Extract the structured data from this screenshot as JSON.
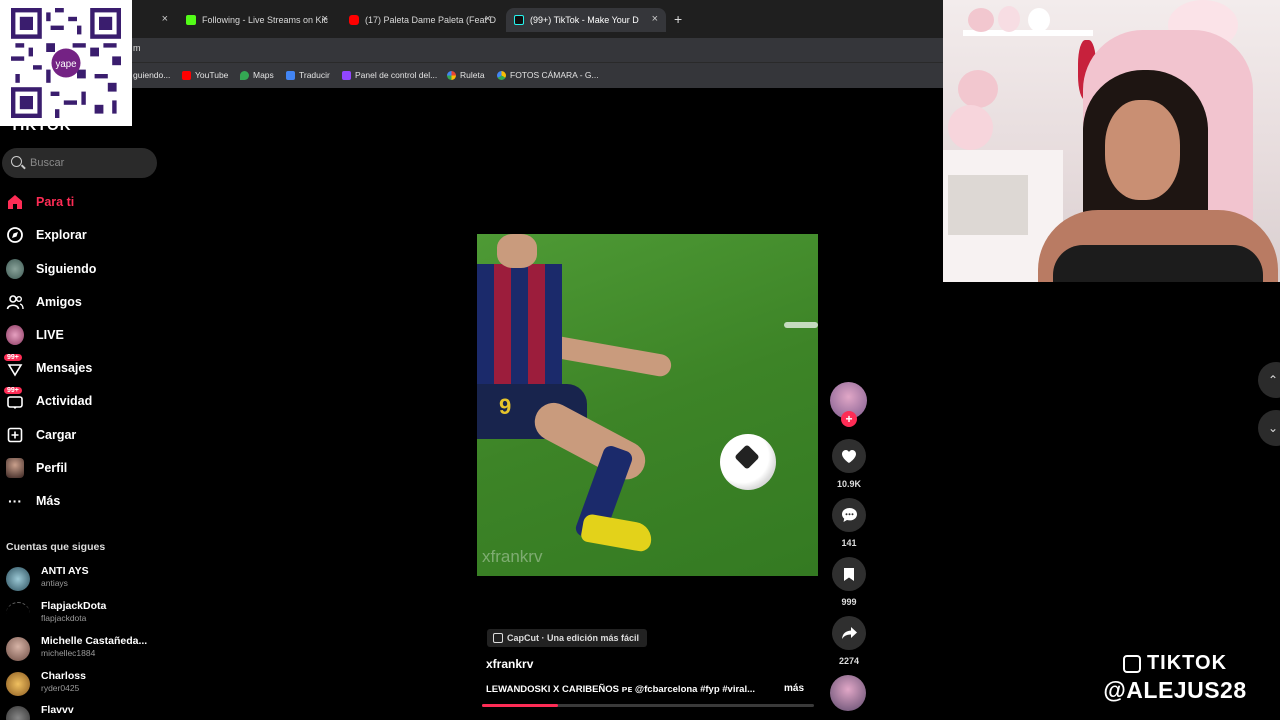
{
  "browser": {
    "tabs": [
      {
        "label": ""
      },
      {
        "label": "Following - Live Streams on Kic"
      },
      {
        "label": "(17) Paleta Dame Paleta (Feat D"
      },
      {
        "label": "(99+) TikTok - Make Your D"
      }
    ],
    "address_fragment": "m",
    "bookmarks": [
      {
        "label": "guiendo...",
        "color": "#8f8f8f"
      },
      {
        "label": "YouTube",
        "color": "#ff0000"
      },
      {
        "label": "Maps",
        "color": "#34a853"
      },
      {
        "label": "Traducir",
        "color": "#4285f4"
      },
      {
        "label": "Panel de control del...",
        "color": "#9146ff"
      },
      {
        "label": "Ruleta",
        "color": "#ea4335"
      },
      {
        "label": "FOTOS CÁMARA - G...",
        "color": "#fbbc04"
      }
    ]
  },
  "qr": {
    "brand": "yape"
  },
  "sidebar": {
    "logo_text": "TIKTOK",
    "search_placeholder": "Buscar",
    "nav": [
      {
        "label": "Para ti",
        "icon": "home-icon",
        "active": true
      },
      {
        "label": "Explorar",
        "icon": "compass-icon"
      },
      {
        "label": "Siguiendo",
        "icon": "following-avatar"
      },
      {
        "label": "Amigos",
        "icon": "friends-icon"
      },
      {
        "label": "LIVE",
        "icon": "live-avatar"
      },
      {
        "label": "Mensajes",
        "icon": "messages-icon",
        "badge": "99+"
      },
      {
        "label": "Actividad",
        "icon": "activity-icon",
        "badge": "99+"
      },
      {
        "label": "Cargar",
        "icon": "upload-icon"
      },
      {
        "label": "Perfil",
        "icon": "profile-avatar"
      },
      {
        "label": "Más",
        "icon": "more-icon"
      }
    ],
    "following_title": "Cuentas que sigues",
    "accounts": [
      {
        "name": "ANTI AYS",
        "user": "antiays",
        "color": "#4a7a8c"
      },
      {
        "name": "FlapjackDota",
        "user": "flapjackdota",
        "color": "#000000"
      },
      {
        "name": "Michelle Castañeda...",
        "user": "michellec1884",
        "color": "#a7837a"
      },
      {
        "name": "Charloss",
        "user": "ryder0425",
        "color": "#c78a3a"
      },
      {
        "name": "Flavvv",
        "user": "",
        "color": "#555555"
      }
    ]
  },
  "video": {
    "watermark": "xfrankrv",
    "jersey_number": "9",
    "progress": 0.23
  },
  "actions": {
    "likes": "10.9K",
    "comments": "141",
    "saves": "999",
    "shares": "2274"
  },
  "caption": {
    "capcut": "CapCut · Una edición más fácil",
    "author": "xfrankrv",
    "description": "LEWANDOSKI X CARIBEÑOS ᴘᴇ @fcbarcelona #fyp #viral...",
    "more": "más"
  },
  "overlay": {
    "line1": "TIKTOK",
    "line2": "@ALEJUS28"
  },
  "colors": {
    "accent": "#fe2c55",
    "background": "#000000"
  }
}
